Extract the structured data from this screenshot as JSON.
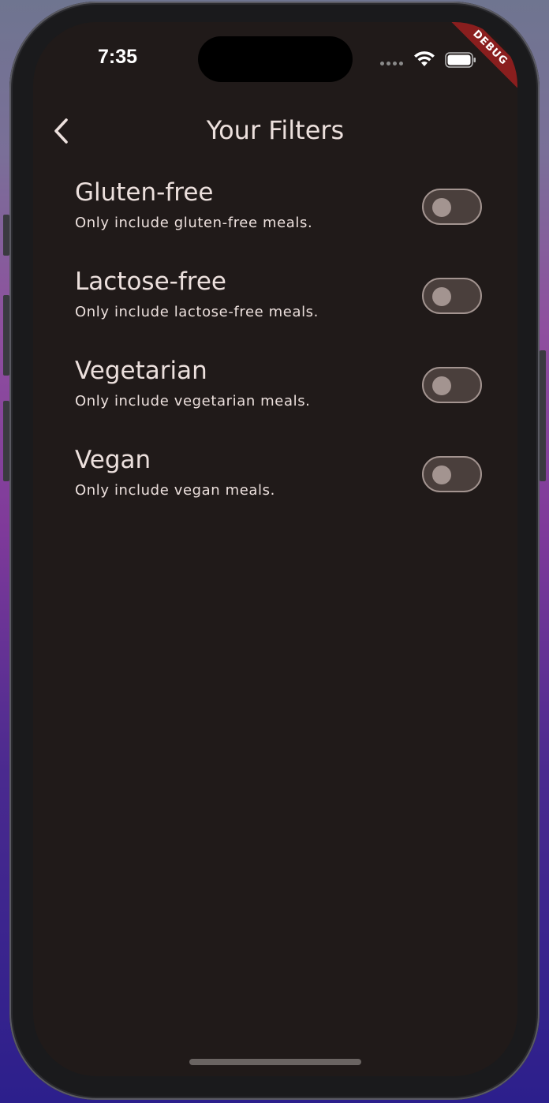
{
  "status_bar": {
    "time": "7:35",
    "debug_banner": "DEBUG"
  },
  "app_bar": {
    "title": "Your Filters",
    "back_icon": "chevron-left-icon"
  },
  "filters": [
    {
      "title": "Gluten-free",
      "subtitle": "Only include gluten-free meals.",
      "enabled": false
    },
    {
      "title": "Lactose-free",
      "subtitle": "Only include lactose-free meals.",
      "enabled": false
    },
    {
      "title": "Vegetarian",
      "subtitle": "Only include vegetarian meals.",
      "enabled": false
    },
    {
      "title": "Vegan",
      "subtitle": "Only include vegan meals.",
      "enabled": false
    }
  ],
  "colors": {
    "background": "#201a19",
    "text": "#ece0dd",
    "switch_track": "#4a3f3c",
    "switch_outline": "#a39490",
    "debug_banner": "#8a1e1e"
  }
}
